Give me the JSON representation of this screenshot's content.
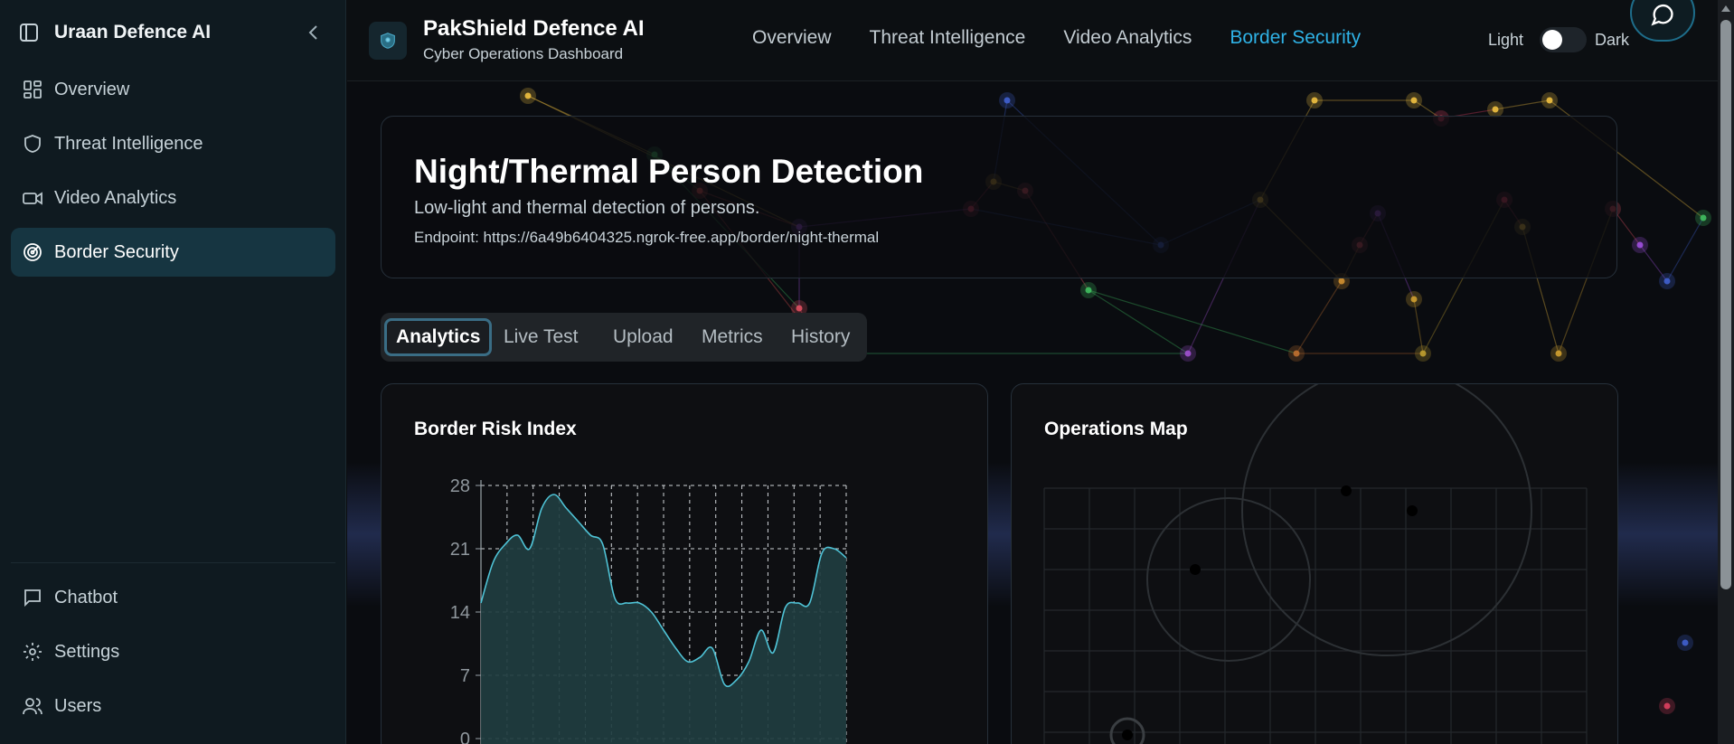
{
  "sidebar": {
    "title": "Uraan Defence AI",
    "items": [
      {
        "label": "Overview",
        "icon": "layout-grid-icon"
      },
      {
        "label": "Threat Intelligence",
        "icon": "shield-icon"
      },
      {
        "label": "Video Analytics",
        "icon": "video-camera-icon"
      },
      {
        "label": "Border Security",
        "icon": "radar-icon",
        "active": true
      }
    ],
    "bottom_items": [
      {
        "label": "Chatbot",
        "icon": "message-square-icon"
      },
      {
        "label": "Settings",
        "icon": "gear-icon"
      },
      {
        "label": "Users",
        "icon": "users-icon"
      }
    ]
  },
  "header": {
    "brand": "PakShield Defence AI",
    "subtitle": "Cyber Operations Dashboard",
    "nav": [
      {
        "label": "Overview"
      },
      {
        "label": "Threat Intelligence"
      },
      {
        "label": "Video Analytics"
      },
      {
        "label": "Border Security",
        "active": true
      }
    ],
    "theme_light": "Light",
    "theme_dark": "Dark"
  },
  "hero": {
    "title": "Night/Thermal Person Detection",
    "description": "Low-light and thermal detection of persons.",
    "endpoint": "Endpoint: https://6a49b6404325.ngrok-free.app/border/night-thermal"
  },
  "tabs": [
    "Analytics",
    "Live Test",
    "Upload",
    "Metrics",
    "History"
  ],
  "risk_card": {
    "title": "Border Risk Index"
  },
  "map_card": {
    "title": "Operations Map"
  },
  "colors": {
    "accent": "#2fb2e6",
    "series": "#4fc3d6",
    "active_nav_bg": "#163541"
  },
  "chart_data": {
    "type": "area",
    "title": "Border Risk Index",
    "xlabel": "",
    "ylabel": "",
    "ylim": [
      0,
      28
    ],
    "yticks": [
      0,
      7,
      14,
      21,
      28
    ],
    "grid": true,
    "values": [
      15,
      19.5,
      21.5,
      22.5,
      21,
      25.5,
      27,
      25.5,
      24,
      22.5,
      21.5,
      15.5,
      15,
      15,
      14,
      12,
      10,
      8.5,
      9,
      10,
      6,
      6.5,
      8.5,
      12,
      9.5,
      14.5,
      15,
      15,
      20.5,
      21,
      20
    ]
  }
}
